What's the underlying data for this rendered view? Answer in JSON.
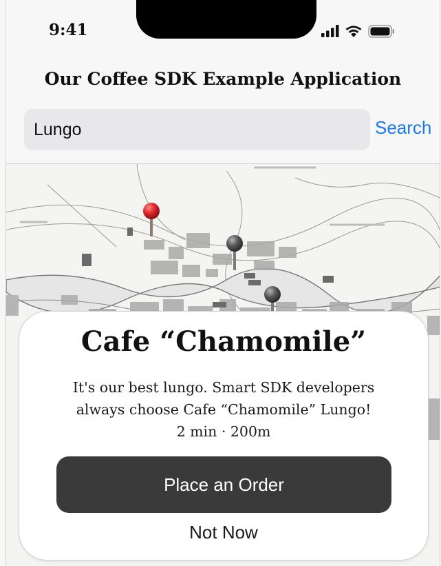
{
  "status_bar": {
    "time": "9:41",
    "icons": [
      "cellular-signal-icon",
      "wifi-icon",
      "battery-icon"
    ]
  },
  "header": {
    "title": "Our Coffee SDK Example Application"
  },
  "search": {
    "value": "Lungo",
    "placeholder": "",
    "button_label": "Search"
  },
  "map": {
    "pins": [
      {
        "name": "selected-cafe-pin",
        "color": "#e0262a"
      },
      {
        "name": "cafe-pin",
        "color": "#5a5a5a"
      },
      {
        "name": "cafe-pin",
        "color": "#5a5a5a"
      }
    ]
  },
  "card": {
    "title": "Cafe “Chamomile”",
    "description": "It's our best lungo. Smart SDK developers always choose Cafe “Chamomile” Lungo!",
    "meta": "2 min · 200m",
    "primary_button": "Place an Order",
    "secondary_button": "Not Now"
  },
  "colors": {
    "accent": "#1a7ae8",
    "button_dark": "#3a3a3a",
    "selected_pin": "#e0262a"
  }
}
